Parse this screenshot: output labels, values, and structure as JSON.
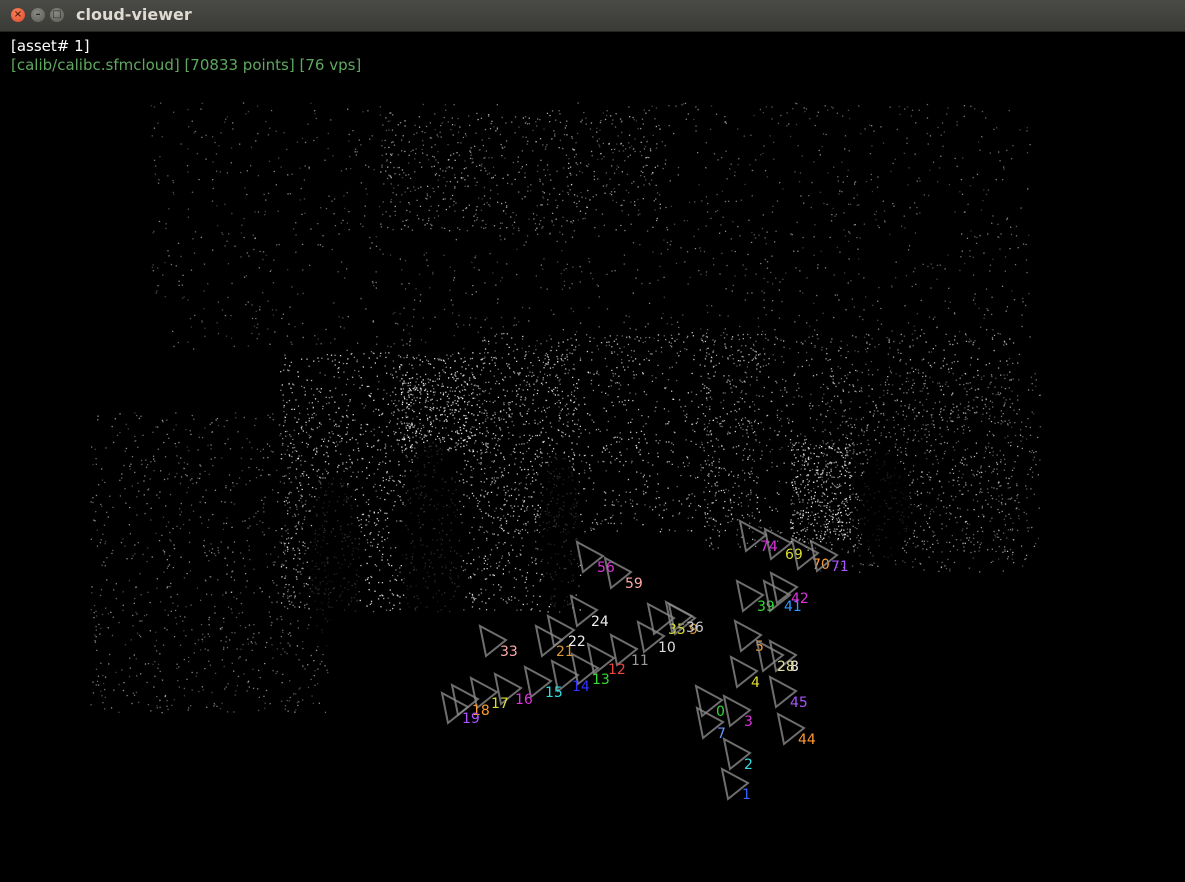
{
  "window": {
    "title": "cloud-viewer",
    "close_glyph": "×",
    "min_glyph": "–",
    "max_glyph": "□"
  },
  "overlay": {
    "asset_line": "[asset# 1]",
    "cloud_line": "[calib/calibc.sfmcloud] [70833 points] [76 vps]"
  },
  "viewpoints": [
    {
      "label": "0",
      "color": "#33dd33"
    },
    {
      "label": "1",
      "color": "#3366ff"
    },
    {
      "label": "2",
      "color": "#33dddd"
    },
    {
      "label": "3",
      "color": "#dd33dd"
    },
    {
      "label": "4",
      "color": "#dddd33"
    },
    {
      "label": "5",
      "color": "#ff9933"
    },
    {
      "label": "7",
      "color": "#6699ff"
    },
    {
      "label": "8",
      "color": "#eeeeee"
    },
    {
      "label": "9",
      "color": "#dd9933"
    },
    {
      "label": "10",
      "color": "#dddddd"
    },
    {
      "label": "11",
      "color": "#999999"
    },
    {
      "label": "12",
      "color": "#ee4444"
    },
    {
      "label": "13",
      "color": "#33dd33"
    },
    {
      "label": "14",
      "color": "#3333ff"
    },
    {
      "label": "15",
      "color": "#33dddd"
    },
    {
      "label": "16",
      "color": "#dd33dd"
    },
    {
      "label": "17",
      "color": "#dddd33"
    },
    {
      "label": "18",
      "color": "#ff9933"
    },
    {
      "label": "19",
      "color": "#aa55ff"
    },
    {
      "label": "21",
      "color": "#dd9933"
    },
    {
      "label": "22",
      "color": "#eeeeee"
    },
    {
      "label": "24",
      "color": "#eeeeee"
    },
    {
      "label": "28",
      "color": "#dddd99"
    },
    {
      "label": "33",
      "color": "#ffaaaa"
    },
    {
      "label": "35",
      "color": "#dddd33"
    },
    {
      "label": "36",
      "color": "#cccccc"
    },
    {
      "label": "39",
      "color": "#33dd33"
    },
    {
      "label": "41",
      "color": "#3399ff"
    },
    {
      "label": "42",
      "color": "#dd33dd"
    },
    {
      "label": "44",
      "color": "#ff9933"
    },
    {
      "label": "45",
      "color": "#aa55ff"
    },
    {
      "label": "56",
      "color": "#dd33dd"
    },
    {
      "label": "59",
      "color": "#ffaaaa"
    },
    {
      "label": "69",
      "color": "#dddd33"
    },
    {
      "label": "70",
      "color": "#ff9933"
    },
    {
      "label": "71",
      "color": "#aa55ff"
    },
    {
      "label": "74",
      "color": "#dd33dd"
    }
  ]
}
